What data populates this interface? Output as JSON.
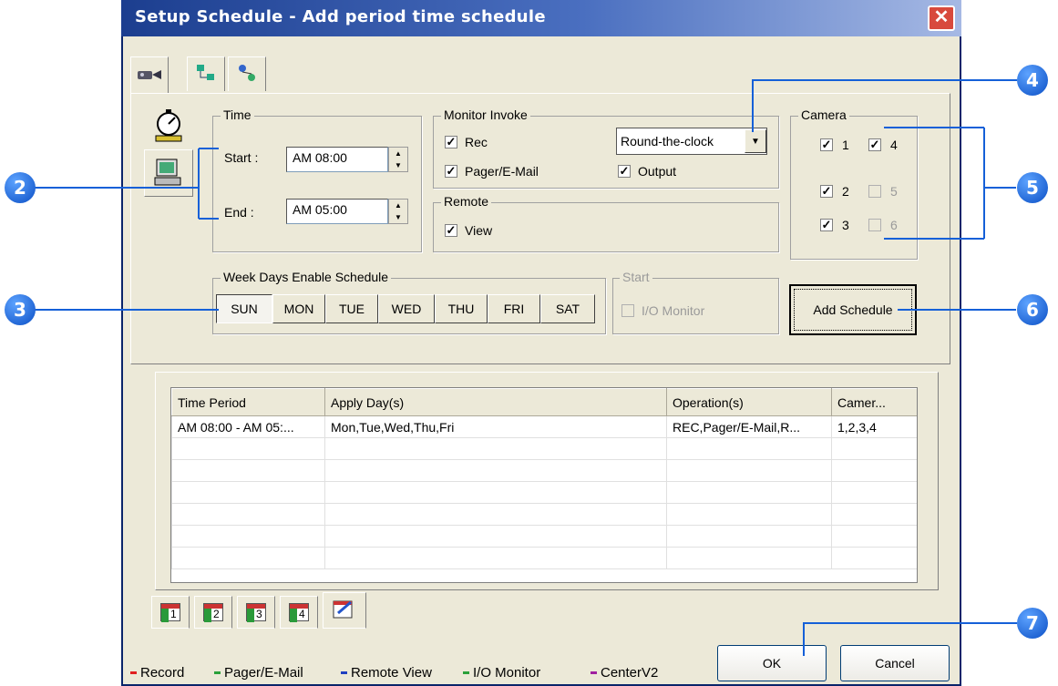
{
  "window": {
    "title": "Setup Schedule - Add period time schedule",
    "close_label": "✕"
  },
  "top_tabs": [
    {
      "icon": "camera-icon"
    },
    {
      "icon": "network-icon"
    },
    {
      "icon": "connection-icon"
    }
  ],
  "time": {
    "legend": "Time",
    "start_label": "Start :",
    "start_value": "AM 08:00",
    "end_label": "End :",
    "end_value": "AM 05:00"
  },
  "monitor_invoke": {
    "legend": "Monitor Invoke",
    "rec_label": "Rec",
    "rec_checked": true,
    "pager_label": "Pager/E-Mail",
    "pager_checked": true,
    "output_label": "Output",
    "output_checked": true,
    "mode_value": "Round-the-clock"
  },
  "remote": {
    "legend": "Remote",
    "view_label": "View",
    "view_checked": true
  },
  "camera": {
    "legend": "Camera",
    "items": [
      {
        "label": "1",
        "checked": true,
        "enabled": true
      },
      {
        "label": "4",
        "checked": true,
        "enabled": true
      },
      {
        "label": "2",
        "checked": true,
        "enabled": true
      },
      {
        "label": "5",
        "checked": false,
        "enabled": false
      },
      {
        "label": "3",
        "checked": true,
        "enabled": true
      },
      {
        "label": "6",
        "checked": false,
        "enabled": false
      }
    ]
  },
  "weekdays": {
    "legend": "Week Days Enable Schedule",
    "days": [
      "SUN",
      "MON",
      "TUE",
      "WED",
      "THU",
      "FRI",
      "SAT"
    ]
  },
  "start_group": {
    "legend": "Start",
    "io_label": "I/O Monitor"
  },
  "add_schedule_label": "Add Schedule",
  "table": {
    "columns": [
      "Time Period",
      "Apply Day(s)",
      "Operation(s)",
      "Camer..."
    ],
    "rows": [
      [
        "AM 08:00 - AM 05:...",
        "Mon,Tue,Wed,Thu,Fri",
        "REC,Pager/E-Mail,R...",
        "1,2,3,4"
      ]
    ],
    "empty_rows": 6
  },
  "bottom_tabs": [
    "1",
    "2",
    "3",
    "4",
    ""
  ],
  "ok_label": "OK",
  "cancel_label": "Cancel",
  "legend_items": [
    {
      "label": "Record",
      "color": "#e02020"
    },
    {
      "label": "Pager/E-Mail",
      "color": "#2aa13a"
    },
    {
      "label": "Remote View",
      "color": "#2040c0"
    },
    {
      "label": "I/O Monitor",
      "color": "#2aa13a"
    },
    {
      "label": "CenterV2",
      "color": "#a020a0"
    }
  ],
  "callouts": [
    "2",
    "3",
    "4",
    "5",
    "6",
    "7"
  ],
  "colors": {
    "callout": "#1560d8",
    "title_bar": "#1c3e8f"
  }
}
